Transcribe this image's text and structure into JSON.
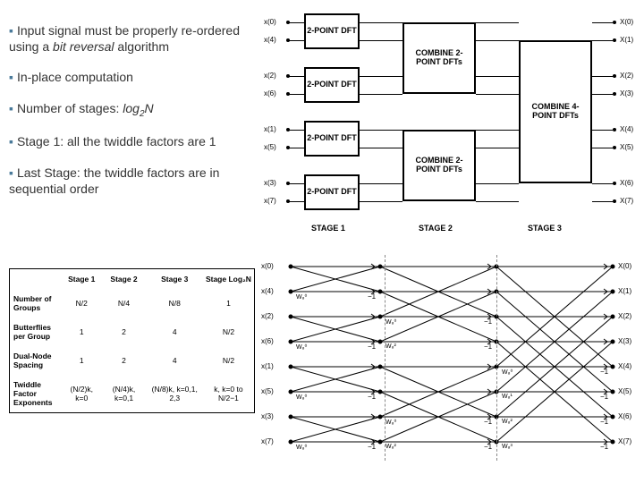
{
  "bullets": {
    "b1": "Input signal must be properly re-ordered using a ",
    "b1_italic": "bit reversal",
    "b1_after": " algorithm",
    "b2": "In-place computation",
    "b3_before": "Number of stages: ",
    "b3_italic": "log",
    "b3_sub": "2",
    "b3_after": "N",
    "b4": "Stage 1: all the twiddle factors are 1",
    "b5": "Last Stage: the twiddle factors are in sequential order"
  },
  "table": {
    "headers": [
      "",
      "Stage 1",
      "Stage 2",
      "Stage 3",
      "Stage Log₂N"
    ],
    "rows": [
      {
        "label": "Number of Groups",
        "cells": [
          "N/2",
          "N/4",
          "N/8",
          "1"
        ]
      },
      {
        "label": "Butterflies per Group",
        "cells": [
          "1",
          "2",
          "4",
          "N/2"
        ]
      },
      {
        "label": "Dual-Node Spacing",
        "cells": [
          "1",
          "2",
          "4",
          "N/2"
        ]
      },
      {
        "label": "Twiddle Factor Exponents",
        "cells": [
          "(N/2)k, k=0",
          "(N/4)k, k=0,1",
          "(N/8)k, k=0,1, 2,3",
          "k, k=0 to N/2−1"
        ]
      }
    ]
  },
  "top_diagram": {
    "inputs": [
      "x(0)",
      "x(4)",
      "x(2)",
      "x(6)",
      "x(1)",
      "x(5)",
      "x(3)",
      "x(7)"
    ],
    "outputs": [
      "X(0)",
      "X(1)",
      "X(2)",
      "X(3)",
      "X(4)",
      "X(5)",
      "X(6)",
      "X(7)"
    ],
    "stage1_box": "2-POINT DFT",
    "stage2_box": "COMBINE 2-POINT DFTs",
    "stage3_box": "COMBINE 4-POINT DFTs",
    "stages": [
      "STAGE 1",
      "STAGE 2",
      "STAGE 3"
    ]
  },
  "bot_diagram": {
    "inputs": [
      "x(0)",
      "x(4)",
      "x(2)",
      "x(6)",
      "x(1)",
      "x(5)",
      "x(3)",
      "x(7)"
    ],
    "outputs": [
      "X(0)",
      "X(1)",
      "X(2)",
      "X(3)",
      "X(4)",
      "X(5)",
      "X(6)",
      "X(7)"
    ],
    "twiddle_s1": [
      "W₈⁰",
      "W₈⁰",
      "W₈⁰",
      "W₈⁰"
    ],
    "twiddle_s2": [
      "W₈⁰",
      "W₈²",
      "W₈⁰",
      "W₈²"
    ],
    "twiddle_s3": [
      "W₈⁰",
      "W₈¹",
      "W₈²",
      "W₈³"
    ],
    "minus1": "−1"
  }
}
